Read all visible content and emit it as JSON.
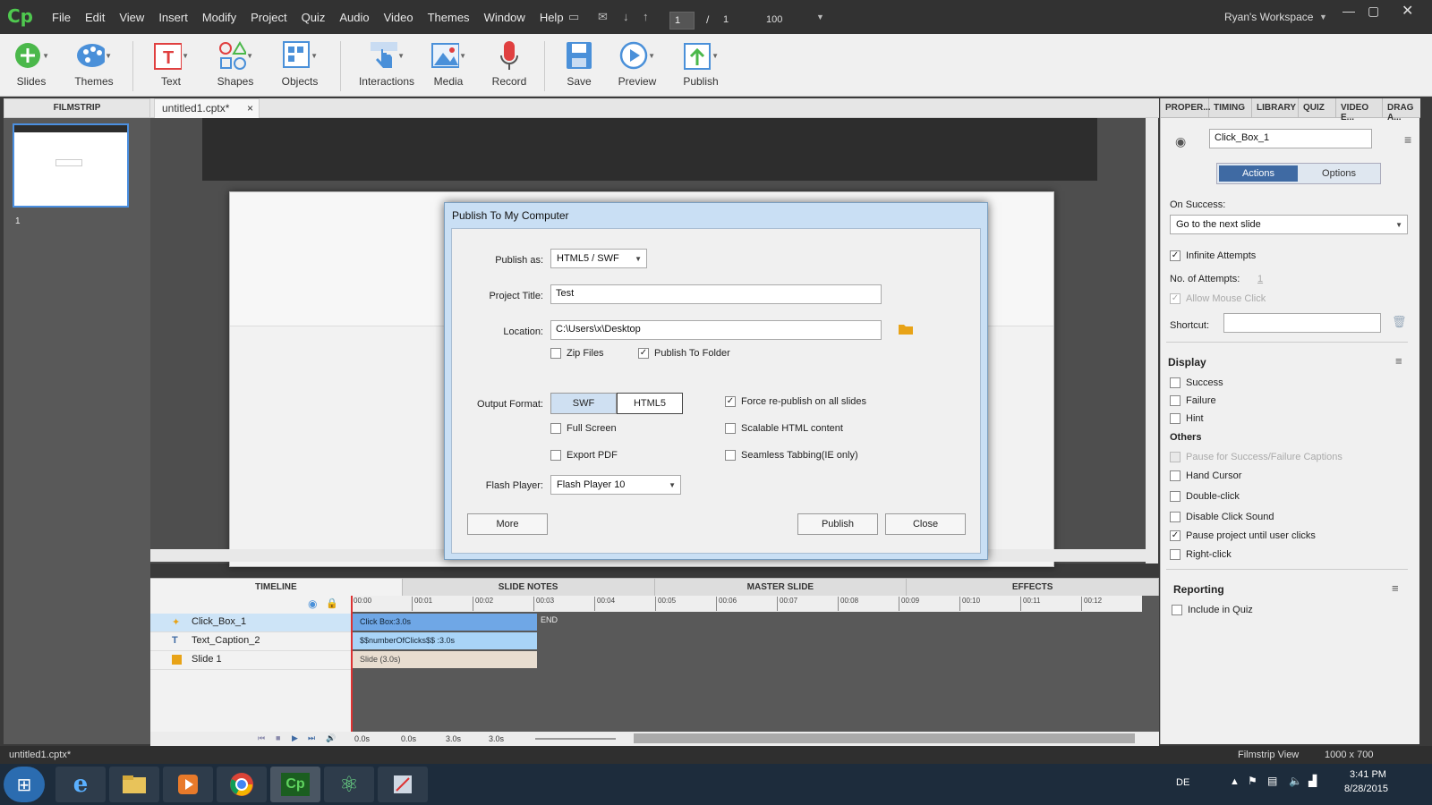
{
  "menubar": {
    "logo": "Cp",
    "items": [
      "File",
      "Edit",
      "View",
      "Insert",
      "Modify",
      "Project",
      "Quiz",
      "Audio",
      "Video",
      "Themes",
      "Window",
      "Help"
    ],
    "page_current": "1",
    "page_sep": "/",
    "page_total": "1",
    "zoom": "100",
    "workspace": "Ryan's Workspace"
  },
  "toolbar": {
    "tools": [
      {
        "label": "Slides",
        "icon": "plus-circle-icon"
      },
      {
        "label": "Themes",
        "icon": "palette-icon"
      },
      {
        "label": "Text",
        "icon": "text-icon"
      },
      {
        "label": "Shapes",
        "icon": "shapes-icon"
      },
      {
        "label": "Objects",
        "icon": "objects-icon"
      },
      {
        "label": "Interactions",
        "icon": "hand-pointer-icon"
      },
      {
        "label": "Media",
        "icon": "image-icon"
      },
      {
        "label": "Record",
        "icon": "microphone-icon"
      },
      {
        "label": "Save",
        "icon": "save-icon"
      },
      {
        "label": "Preview",
        "icon": "play-icon"
      },
      {
        "label": "Publish",
        "icon": "publish-icon"
      }
    ]
  },
  "filmstrip": {
    "header": "FILMSTRIP",
    "slide_number": "1"
  },
  "doc_tab": {
    "label": "untitled1.cptx*",
    "close": "×"
  },
  "dialog": {
    "title": "Publish To My Computer",
    "publish_as_label": "Publish as:",
    "publish_as_value": "HTML5 / SWF",
    "project_title_label": "Project Title:",
    "project_title_value": "Test",
    "location_label": "Location:",
    "location_value": "C:\\Users\\x\\Desktop",
    "zip_files": "Zip Files",
    "publish_to_folder": "Publish To Folder",
    "output_format_label": "Output Format:",
    "swf": "SWF",
    "html5": "HTML5",
    "force_republish": "Force re-publish on all slides",
    "full_screen": "Full Screen",
    "scalable_html": "Scalable HTML content",
    "export_pdf": "Export PDF",
    "seamless_tabbing": "Seamless Tabbing(IE only)",
    "flash_player_label": "Flash Player:",
    "flash_player_value": "Flash Player 10",
    "more": "More",
    "publish": "Publish",
    "close": "Close"
  },
  "right_panel": {
    "tabs": [
      "PROPER...",
      "TIMING",
      "LIBRARY",
      "QUIZ",
      "VIDEO E...",
      "DRAG A..."
    ],
    "object_name": "Click_Box_1",
    "actions_tab": "Actions",
    "options_tab": "Options",
    "on_success_label": "On Success:",
    "on_success_value": "Go to the next slide",
    "infinite_attempts": "Infinite Attempts",
    "no_attempts_label": "No. of Attempts:",
    "no_attempts_value": "1",
    "allow_mouse_click": "Allow Mouse Click",
    "shortcut_label": "Shortcut:",
    "display_header": "Display",
    "success": "Success",
    "failure": "Failure",
    "hint": "Hint",
    "others_header": "Others",
    "pause_captions": "Pause for Success/Failure Captions",
    "hand_cursor": "Hand Cursor",
    "double_click": "Double-click",
    "disable_click_sound": "Disable Click Sound",
    "pause_project": "Pause project until user clicks",
    "right_click": "Right-click",
    "reporting_header": "Reporting",
    "include_in_quiz": "Include in Quiz"
  },
  "bottom_tabs": [
    "TIMELINE",
    "SLIDE NOTES",
    "MASTER SLIDE",
    "EFFECTS"
  ],
  "timeline": {
    "rows": [
      {
        "name": "Click_Box_1",
        "bar": "Click Box:3.0s"
      },
      {
        "name": "Text_Caption_2",
        "bar": "$$numberOfClicks$$ :3.0s"
      },
      {
        "name": "Slide 1",
        "bar": "Slide (3.0s)"
      }
    ],
    "end_label": "END",
    "ruler": [
      "00:00",
      "00:01",
      "00:02",
      "00:03",
      "00:04",
      "00:05",
      "00:06",
      "00:07",
      "00:08",
      "00:09",
      "00:10",
      "00:11",
      "00:12"
    ],
    "readouts": [
      "0.0s",
      "0.0s",
      "3.0s",
      "3.0s"
    ]
  },
  "statusbar": {
    "file": "untitled1.cptx*",
    "view": "Filmstrip View",
    "size": "1000 x 700"
  },
  "taskbar": {
    "lang": "DE",
    "time": "3:41 PM",
    "date": "8/28/2015"
  },
  "colors": {
    "accent": "#4b8fe0",
    "dialog_frame": "#c9dff4",
    "timeline_bar": "#8cc4f5"
  }
}
